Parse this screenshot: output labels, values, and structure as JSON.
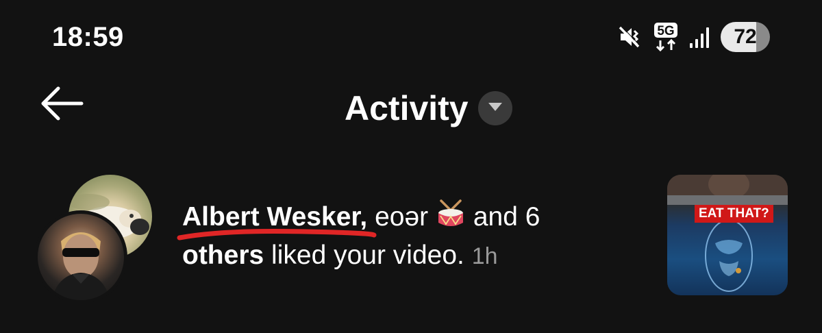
{
  "status_bar": {
    "time": "18:59",
    "network": "5G",
    "battery": "72",
    "icons": [
      "mute-vibrate-icon",
      "5g-data-icon",
      "signal-icon",
      "battery-icon"
    ]
  },
  "header": {
    "title": "Activity",
    "back_icon": "arrow-left-icon",
    "dropdown_icon": "triangle-down-icon"
  },
  "notification": {
    "name": "Albert Wesker",
    "comma_after_name": ",",
    "second_user": "eoər",
    "second_user_emoji": "drum-emoji",
    "and_count": "and 6",
    "others": "others",
    "action": "liked your video.",
    "time_ago": "1h",
    "thumbnail_caption": "EAT THAT?"
  },
  "colors": {
    "background": "#121212",
    "text": "#ffffff",
    "muted_text": "#9a9a9a",
    "underline_annotation": "#e02626",
    "thumbnail_banner": "#d01818"
  }
}
